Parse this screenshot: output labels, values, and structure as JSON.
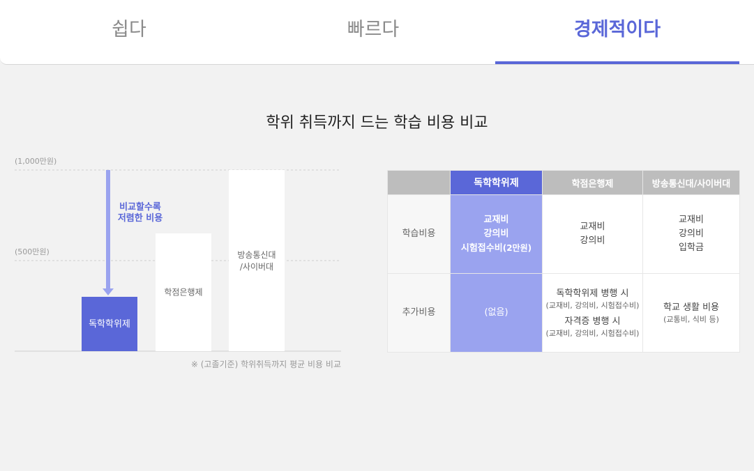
{
  "tabs": [
    {
      "label": "쉽다",
      "active": false
    },
    {
      "label": "빠르다",
      "active": false
    },
    {
      "label": "경제적이다",
      "active": true
    }
  ],
  "section_title": "학위 취득까지 드는 학습 비용 비교",
  "chart_data": {
    "type": "bar",
    "categories": [
      "독학학위제",
      "학점은행제",
      "방송통신대\n/사이버대"
    ],
    "values": [
      300,
      650,
      1000
    ],
    "ylim": [
      0,
      1000
    ],
    "yticks": [
      {
        "value": 1000,
        "label": "(1,000만원)"
      },
      {
        "value": 500,
        "label": "(500만원)"
      }
    ],
    "annotation": "비교할수록\n저렴한 비용",
    "note": "※ (고졸기준) 학위취득까지 평균 비용 비교",
    "colors": {
      "highlight": "#5a67d8",
      "arrow": "#9aa3ef",
      "bar": "#ffffff",
      "label": "#666666"
    }
  },
  "table": {
    "headers": [
      "",
      "독학학위제",
      "학점은행제",
      "방송통신대/사이버대"
    ],
    "rows": [
      {
        "head": "학습비용",
        "cells": [
          {
            "lines": [
              "교재비",
              "강의비",
              "시험접수비"
            ],
            "suffix": "(2만원)"
          },
          {
            "lines": [
              "교재비",
              "강의비"
            ]
          },
          {
            "lines": [
              "교재비",
              "강의비",
              "입학금"
            ]
          }
        ]
      },
      {
        "head": "추가비용",
        "cells": [
          {
            "lines": [
              "(없음)"
            ]
          },
          {
            "blocks": [
              {
                "main": "독학학위제 병행 시",
                "sub": "(교재비, 강의비, 시험접수비)"
              },
              {
                "main": "자격증 병행 시",
                "sub": "(교재비, 강의비, 시험접수비)"
              }
            ]
          },
          {
            "blocks": [
              {
                "main": "학교 생활 비용",
                "sub": "(교통비, 식비 등)"
              }
            ]
          }
        ]
      }
    ]
  },
  "colors": {
    "accent": "#5a67d8",
    "accent_light": "#9aa3ef",
    "header_gray": "#bdbdbd",
    "background": "#f2f2f2"
  }
}
